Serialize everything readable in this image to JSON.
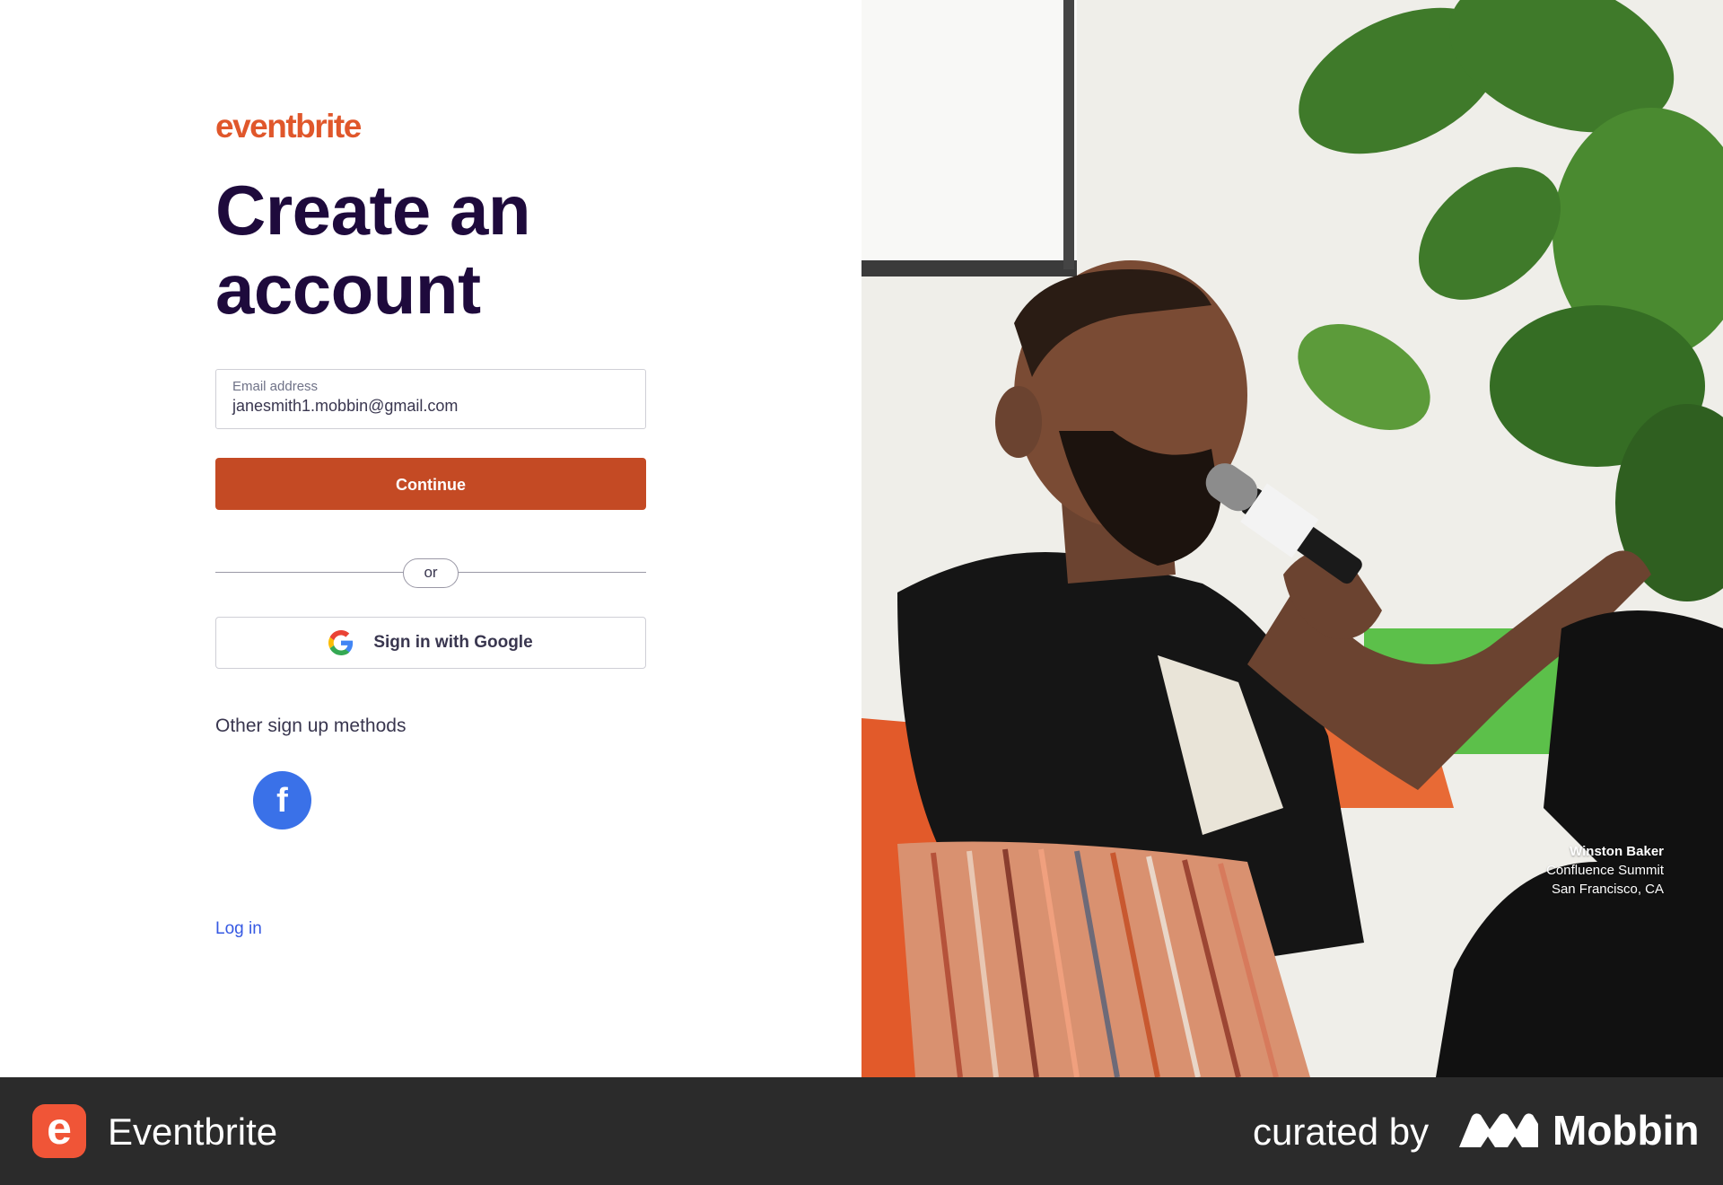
{
  "brand": {
    "logo_text": "eventbrite",
    "logo_color": "#e0572b"
  },
  "form": {
    "title": "Create an account",
    "email_label": "Email address",
    "email_value": "janesmith1.mobbin@gmail.com",
    "continue_label": "Continue",
    "continue_color": "#c44a24",
    "or_label": "or",
    "google_label": "Sign in with Google",
    "google_icon": "google-g-icon",
    "other_methods_label": "Other sign up methods",
    "facebook_icon": "facebook-f-icon",
    "facebook_color": "#3a71e8",
    "login_label": "Log in"
  },
  "photo": {
    "caption_name": "Winston Baker",
    "caption_event": "Confluence Summit",
    "caption_location": "San Francisco, CA"
  },
  "footer": {
    "app_icon": "eventbrite-e-icon",
    "app_icon_glyph": "e",
    "app_name": "Eventbrite",
    "curated_label": "curated by",
    "mobbin_icon": "mobbin-logo-icon",
    "mobbin_name": "Mobbin"
  }
}
